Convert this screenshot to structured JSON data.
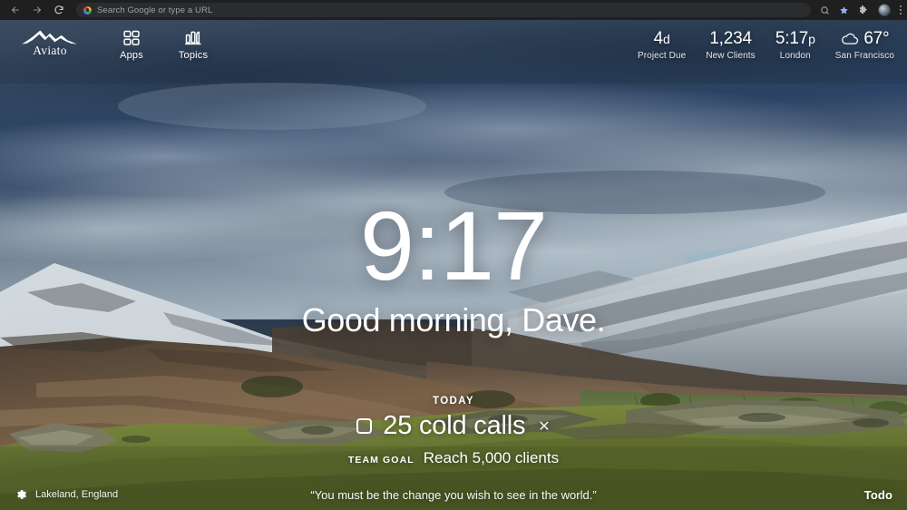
{
  "browser": {
    "back_icon": "back-arrow-icon",
    "forward_icon": "forward-arrow-icon",
    "reload_icon": "reload-icon",
    "omnibox_placeholder": "Search Google or type a URL",
    "omnibox_value": "",
    "search_icon": "search-icon",
    "bookmark_icon": "star-icon",
    "extensions_icon": "puzzle-piece-icon",
    "profile_icon": "profile-avatar-icon",
    "menu_icon": "kebab-menu-icon"
  },
  "topbar": {
    "brand": {
      "name": "Aviato",
      "icon": "mountain-logo-icon"
    },
    "nav": [
      {
        "label": "Apps",
        "icon": "grid-apps-icon"
      },
      {
        "label": "Topics",
        "icon": "bar-chart-topics-icon"
      }
    ],
    "stats": [
      {
        "value": "4",
        "unit": "d",
        "label": "Project Due"
      },
      {
        "value": "1,234",
        "unit": "",
        "label": "New Clients"
      },
      {
        "value": "5:17",
        "unit": "p",
        "label": "London"
      },
      {
        "value": "67°",
        "unit": "",
        "label": "San Francisco",
        "icon": "cloud-weather-icon"
      }
    ]
  },
  "center": {
    "clock": "9:17",
    "greeting": "Good morning, Dave."
  },
  "todo": {
    "section_label": "TODAY",
    "checkbox_icon": "checkbox-unchecked-icon",
    "item_text": "25 cold calls",
    "dismiss_icon": "close-x-icon",
    "goal_label": "TEAM GOAL",
    "goal_text": "Reach 5,000 clients"
  },
  "bottombar": {
    "settings_icon": "gear-icon",
    "location": "Lakeland, England",
    "quote": "“You must be the change you wish to see in the world.”",
    "todo_link": "Todo"
  },
  "colors": {
    "chrome_bg": "#1f1f20",
    "omnibox_bg": "#2b2c2e",
    "accent_blue": "#8ab4f8",
    "text_primary": "#ffffff",
    "sky_top": "#39475c",
    "sky_blue": "#2e4a6b",
    "mountain_snow": "#cfd6da",
    "moor_brown": "#6d5a47",
    "grass_green": "#6d7a38"
  }
}
